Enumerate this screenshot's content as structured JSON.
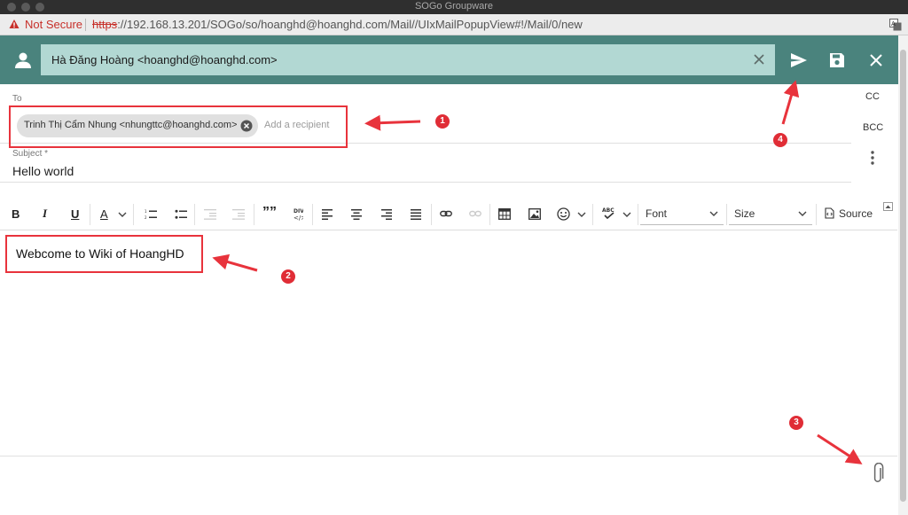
{
  "window": {
    "title": "SOGo Groupware"
  },
  "address_bar": {
    "security_label": "Not Secure",
    "url_scheme": "https",
    "url_rest": "://192.168.13.201/SOGo/so/hoanghd@hoanghd.com/Mail//UIxMailPopupView#!/Mail/0/new"
  },
  "composer": {
    "from": "Hà Đăng Hoàng <hoanghd@hoanghd.com>",
    "to_label": "To",
    "recipients": [
      "Trinh Thị Cẩm Nhung <nhungttc@hoanghd.com>"
    ],
    "add_recipient_placeholder": "Add a recipient",
    "cc_label": "CC",
    "bcc_label": "BCC",
    "subject_label": "Subject *",
    "subject_value": "Hello world",
    "body_text": "Webcome to Wiki of HoangHD"
  },
  "editor_toolbar": {
    "bold": "B",
    "italic": "I",
    "underline": "U",
    "font_color": "A",
    "blockquote": "””",
    "font_label": "Font",
    "size_label": "Size",
    "source_label": "Source"
  },
  "annotations": [
    "1",
    "2",
    "3",
    "4"
  ],
  "colors": {
    "toolbar_bg": "#4a837d",
    "from_field_bg": "#b2d8d3",
    "annotation_red": "#e8333c",
    "not_secure_red": "#c7302a"
  }
}
